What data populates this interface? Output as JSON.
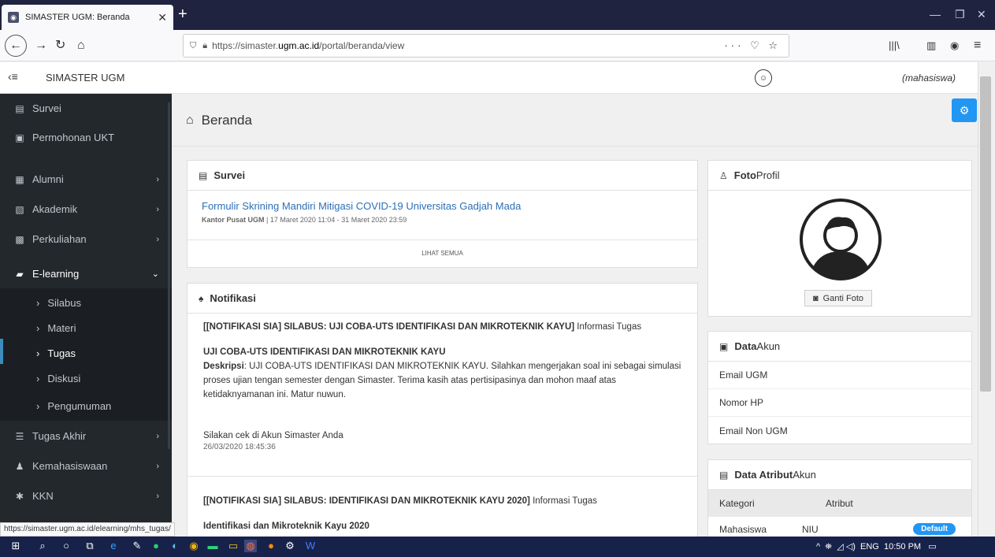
{
  "browser": {
    "tab_title": "SIMASTER UGM: Beranda",
    "tab_close": "✕",
    "new_tab": "+",
    "url_prefix": "https://simaster.",
    "url_domain": "ugm.ac.id",
    "url_path": "/portal/beranda/view",
    "url_right_icons": "··· ♡ ☆",
    "status_url": "https://simaster.ugm.ac.id/elearning/mhs_tugas/"
  },
  "app": {
    "brand": "SIMASTER UGM",
    "role": "(mahasiswa)"
  },
  "sidebar": {
    "items": [
      {
        "label": "Survei",
        "icon": "list-icon"
      },
      {
        "label": "Permohonan UKT",
        "icon": "money-icon"
      },
      {
        "label": "Alumni",
        "icon": "briefcase-icon"
      },
      {
        "label": "Akademik",
        "icon": "id-card-icon"
      },
      {
        "label": "Perkuliahan",
        "icon": "calendar-icon"
      },
      {
        "label": "E-learning",
        "icon": "book-icon"
      },
      {
        "label": "Silabus"
      },
      {
        "label": "Materi"
      },
      {
        "label": "Tugas"
      },
      {
        "label": "Diskusi"
      },
      {
        "label": "Pengumuman"
      },
      {
        "label": "Tugas Akhir",
        "icon": "form-icon"
      },
      {
        "label": "Kemahasiswaan",
        "icon": "users-icon"
      },
      {
        "label": "KKN",
        "icon": "asterisk-icon"
      }
    ]
  },
  "page": {
    "title": "Beranda"
  },
  "survei": {
    "heading": "Survei",
    "link": "Formulir Skrining Mandiri Mitigasi COVID-19 Universitas Gadjah Mada",
    "source": "Kantor Pusat UGM",
    "dates": " | 17 Maret 2020 11:04 - 31 Maret 2020 23:59",
    "see_all": "LIHAT SEMUA"
  },
  "notifikasi": {
    "heading": "Notifikasi",
    "n1_title_bold": "[[NOTIFIKASI SIA] SILABUS: UJI COBA-UTS IDENTIFIKASI DAN MIKROTEKNIK KAYU]",
    "n1_title_rest": " Informasi Tugas",
    "n1_sub": "UJI COBA-UTS IDENTIFIKASI DAN MIKROTEKNIK KAYU",
    "n1_desc_label": "Deskripsi",
    "n1_desc": ": UJI COBA-UTS IDENTIFIKASI DAN MIKROTEKNIK KAYU. Silahkan mengerjakan soal ini sebagai simulasi proses ujian tengan semester dengan Simaster. Terima kasih atas pertisipasinya dan mohon maaf atas ketidaknyamanan ini. Matur nuwun.",
    "n1_footer": "Silakan cek di Akun Simaster Anda",
    "n1_time": "26/03/2020 18:45:36",
    "n2_title_bold": "[[NOTIFIKASI SIA] SILABUS: IDENTIFIKASI DAN MIKROTEKNIK KAYU 2020]",
    "n2_title_rest": " Informasi Tugas",
    "n2_sub": "Identifikasi dan Mikroteknik Kayu 2020"
  },
  "foto": {
    "heading_bold": "Foto",
    "heading_rest": " Profil",
    "change_btn": "Ganti Foto"
  },
  "akun": {
    "heading_bold": "Data",
    "heading_rest": " Akun",
    "rows": [
      "Email UGM",
      "Nomor HP",
      "Email Non UGM"
    ]
  },
  "atribut": {
    "heading_bold": "Data Atribut",
    "heading_rest": " Akun",
    "col1": "Kategori",
    "col2": "Atribut",
    "r1c1": "Mahasiswa",
    "r1c2": "NIU",
    "badge": "Default"
  },
  "taskbar": {
    "tray_text": "ENG",
    "time": "10:50 PM"
  }
}
